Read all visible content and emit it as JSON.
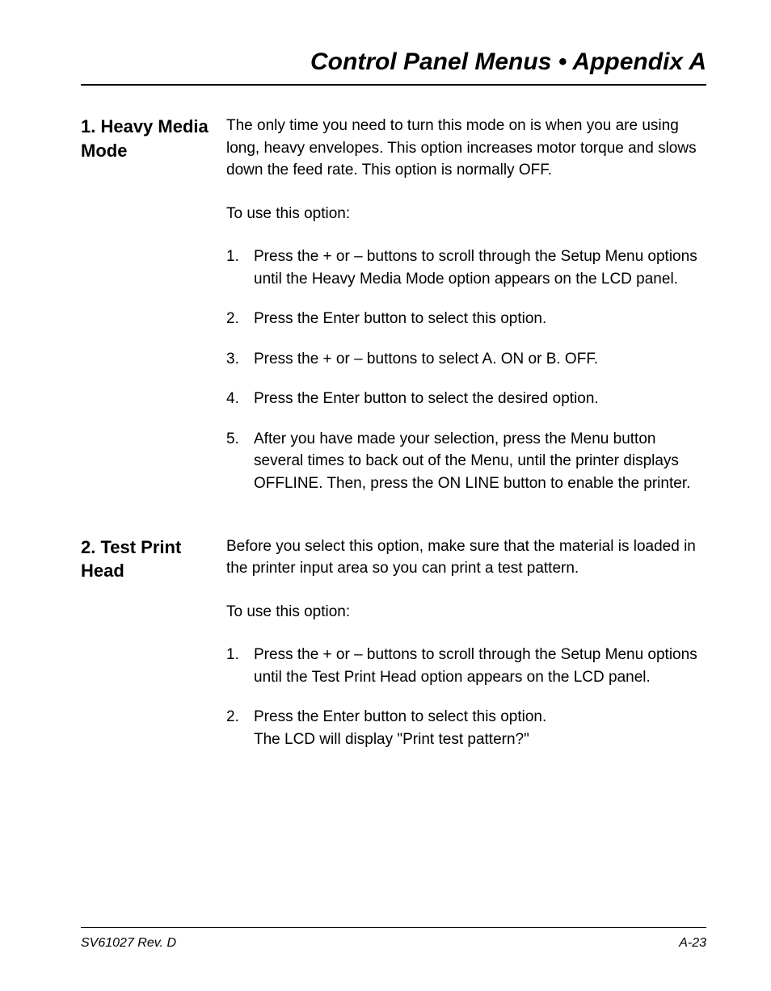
{
  "header": {
    "title": "Control Panel Menus • Appendix A"
  },
  "sections": [
    {
      "heading": "1. Heavy Media  Mode",
      "intro": "The only time you need to turn this mode on is when you are using long, heavy envelopes. This option  increases motor torque and slows down the feed rate. This option is normally OFF.",
      "lead": "To use this option:",
      "items": [
        "Press the + or – buttons to scroll through the Setup Menu options until the Heavy Media Mode option  appears on the LCD panel.",
        "Press the Enter button to select this option.",
        "Press the + or – buttons to select A. ON or B. OFF.",
        "Press the Enter button to select the desired option.",
        "After you have made your selection, press the Menu button several times to back out of the Menu, until the printer displays OFFLINE. Then, press the ON LINE button to enable the printer."
      ]
    },
    {
      "heading": "2. Test Print Head",
      "intro": "Before you select this option, make sure that the material is loaded in the printer input area so you can print a test pattern.",
      "lead": "To use this option:",
      "items": [
        "Press the + or – buttons to scroll through the Setup Menu options until the Test Print Head option appears on the LCD panel.",
        "Press the Enter button to select this option.\nThe LCD will display \"Print test pattern?\""
      ]
    }
  ],
  "footer": {
    "left": "SV61027 Rev. D",
    "right": "A-23"
  }
}
